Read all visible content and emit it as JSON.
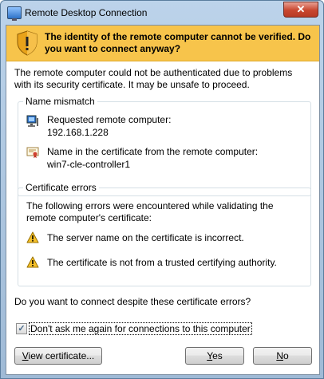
{
  "window": {
    "title": "Remote Desktop Connection",
    "close_glyph": "✕"
  },
  "banner": {
    "text": "The identity of the remote computer cannot be verified. Do you want to connect anyway?"
  },
  "intro": "The remote computer could not be authenticated due to problems with its security certificate. It may be unsafe to proceed.",
  "name_mismatch": {
    "label": "Name mismatch",
    "requested_label": "Requested remote computer:",
    "requested_value": "192.168.1.228",
    "cert_label": "Name in the certificate from the remote computer:",
    "cert_value": "win7-cle-controller1"
  },
  "cert_errors": {
    "label": "Certificate errors",
    "intro": "The following errors were encountered while validating the remote computer's certificate:",
    "errors": [
      "The server name on the certificate is incorrect.",
      "The certificate is not from a trusted certifying authority."
    ]
  },
  "question": "Do you want to connect despite these certificate errors?",
  "checkbox": {
    "label": "Don't ask me again for connections to this computer",
    "checked": true,
    "mark": "✓"
  },
  "buttons": {
    "view_cert": {
      "accel": "V",
      "rest": "iew certificate..."
    },
    "yes": {
      "accel": "Y",
      "rest": "es"
    },
    "no": {
      "accel": "N",
      "rest": "o"
    }
  },
  "colors": {
    "banner": "#f7c44b",
    "frame": "#9fbad6"
  },
  "icons": {
    "banner": "shield-warning-icon",
    "computer": "computer-icon",
    "certificate": "certificate-icon",
    "warning": "warning-icon"
  }
}
